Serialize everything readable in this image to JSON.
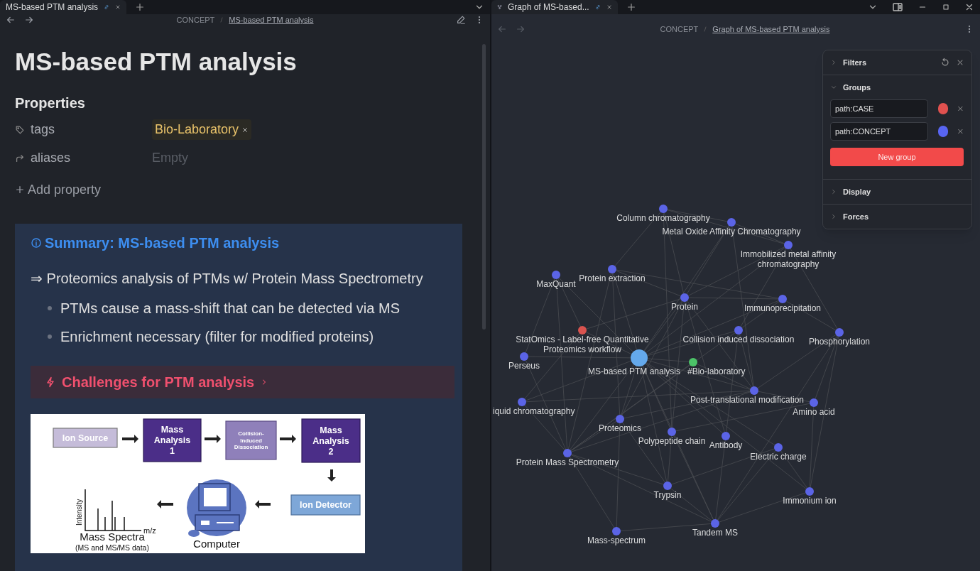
{
  "left_pane": {
    "tab": {
      "title": "MS-based PTM analysis"
    },
    "breadcrumb": {
      "folder": "CONCEPT",
      "note": "MS-based PTM analysis"
    },
    "note": {
      "title": "MS-based PTM analysis",
      "properties_heading": "Properties",
      "properties": [
        {
          "name": "tags",
          "kind": "tags",
          "values": [
            "Bio-Laboratory"
          ]
        },
        {
          "name": "aliases",
          "kind": "list",
          "placeholder": "Empty"
        }
      ],
      "add_property": "Add property",
      "callout": {
        "title": "Summary: MS-based PTM analysis",
        "lead": "⇒ Proteomics analysis of PTMs w/ Protein Mass Spectrometry",
        "bullets": [
          "PTMs cause a mass-shift that can be detected via MS",
          "Enrichment necessary (filter for modified proteins)"
        ],
        "nested_callout": {
          "title": "Challenges for PTM analysis",
          "collapsed": true
        },
        "figure": {
          "boxes": [
            {
              "text": "Ion Source",
              "kind": "light"
            },
            {
              "text": "Mass\nAnalysis\n1",
              "kind": "dark"
            },
            {
              "text": "Collision-\nInduced\nDissociation",
              "kind": "medium"
            },
            {
              "text": "Mass\nAnalysis\n2",
              "kind": "dark"
            },
            {
              "text": "Ion Detector",
              "kind": "blue"
            }
          ],
          "computer_caption": "Computer",
          "spectrum": {
            "ylabel": "Intensity",
            "xlabel": "m/z",
            "caption": "Mass Spectra",
            "subcaption": "(MS and MS/MS data)"
          }
        }
      }
    }
  },
  "right_pane": {
    "tab": {
      "title": "Graph of MS-based..."
    },
    "breadcrumb": {
      "folder": "CONCEPT",
      "note": "Graph of MS-based PTM analysis"
    },
    "graph": {
      "nodes": [
        {
          "label": "Column chromatography",
          "kind": "note",
          "color": "#5b64e6"
        },
        {
          "label": "Metal Oxide Affinity Chromatography",
          "kind": "note",
          "color": "#5b64e6"
        },
        {
          "label": "Immobilized metal affinity\nchromatography",
          "kind": "note",
          "color": "#5b64e6"
        },
        {
          "label": "MaxQuant",
          "kind": "note",
          "color": "#5b64e6"
        },
        {
          "label": "Protein extraction",
          "kind": "note",
          "color": "#5b64e6"
        },
        {
          "label": "Protein",
          "kind": "note",
          "color": "#5b64e6"
        },
        {
          "label": "Immunoprecipitation",
          "kind": "note",
          "color": "#5b64e6"
        },
        {
          "label": "StatOmics - Label-free Quantitative\nProteomics workflow",
          "kind": "note",
          "color": "#d9534f"
        },
        {
          "label": "Perseus",
          "kind": "note",
          "color": "#5b64e6"
        },
        {
          "label": "Collision induced dissociation",
          "kind": "note",
          "color": "#5b64e6"
        },
        {
          "label": "Phosphorylation",
          "kind": "note",
          "color": "#5b64e6"
        },
        {
          "label": "MS-based PTM analysis",
          "kind": "current",
          "color": "#64a9ec"
        },
        {
          "label": "#Bio-laboratory",
          "kind": "tag",
          "color": "#4cc368"
        },
        {
          "label": "Post-translational modification",
          "kind": "note",
          "color": "#5b64e6"
        },
        {
          "label": "Amino acid",
          "kind": "note",
          "color": "#5b64e6"
        },
        {
          "label": "iquid chromatography",
          "kind": "note",
          "color": "#5b64e6"
        },
        {
          "label": "Proteomics",
          "kind": "note",
          "color": "#5b64e6"
        },
        {
          "label": "Polypeptide chain",
          "kind": "note",
          "color": "#5b64e6"
        },
        {
          "label": "Antibody",
          "kind": "note",
          "color": "#5b64e6"
        },
        {
          "label": "Electric charge",
          "kind": "note",
          "color": "#5b64e6"
        },
        {
          "label": "Protein Mass Spectrometry",
          "kind": "note",
          "color": "#5b64e6"
        },
        {
          "label": "Trypsin",
          "kind": "note",
          "color": "#5b64e6"
        },
        {
          "label": "Immonium ion",
          "kind": "note",
          "color": "#5b64e6"
        },
        {
          "label": "Mass-spectrum",
          "kind": "note",
          "color": "#5b64e6"
        },
        {
          "label": "Tandem MS",
          "kind": "note",
          "color": "#5b64e6"
        }
      ]
    },
    "controls": {
      "sections": [
        {
          "title": "Filters",
          "expanded": false
        },
        {
          "title": "Groups",
          "expanded": true,
          "groups": [
            {
              "query": "path:CASE",
              "color": "#e0514f"
            },
            {
              "query": "path:CONCEPT",
              "color": "#5865f2"
            }
          ],
          "button": "New group"
        },
        {
          "title": "Display",
          "expanded": false
        },
        {
          "title": "Forces",
          "expanded": false
        }
      ]
    }
  }
}
